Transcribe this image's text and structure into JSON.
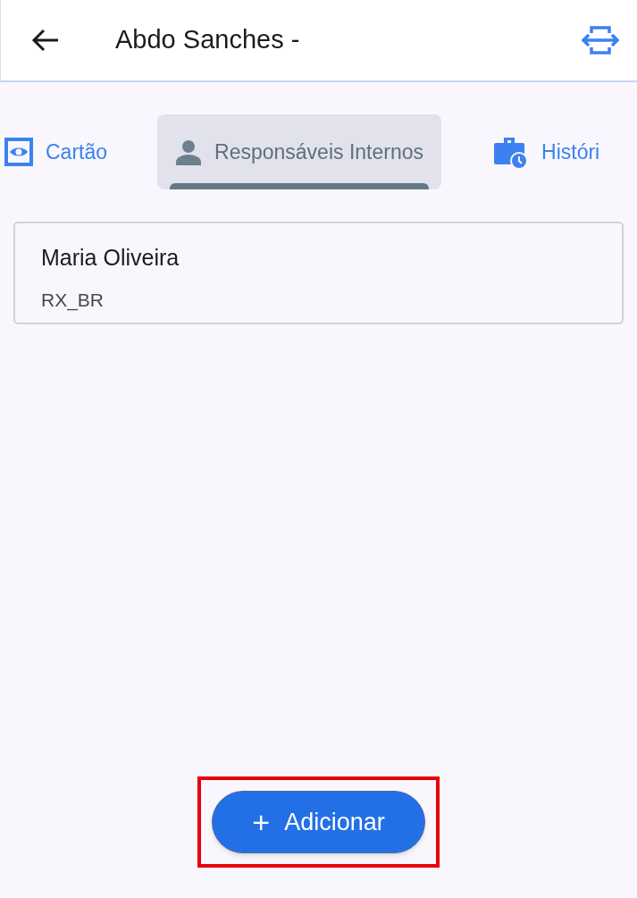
{
  "header": {
    "title": "Abdo Sanches -"
  },
  "tabs": [
    {
      "kind": "eye",
      "label": "Cartão",
      "selected": false
    },
    {
      "kind": "person",
      "label": "Responsáveis Internos",
      "selected": true
    },
    {
      "kind": "briefcase",
      "label": "Históri",
      "selected": false
    }
  ],
  "responsibles": [
    {
      "name": "Maria Oliveira",
      "subtitle": "RX_BR"
    }
  ],
  "add_button": {
    "label": "Adicionar",
    "icon": "+"
  },
  "highlight": true
}
